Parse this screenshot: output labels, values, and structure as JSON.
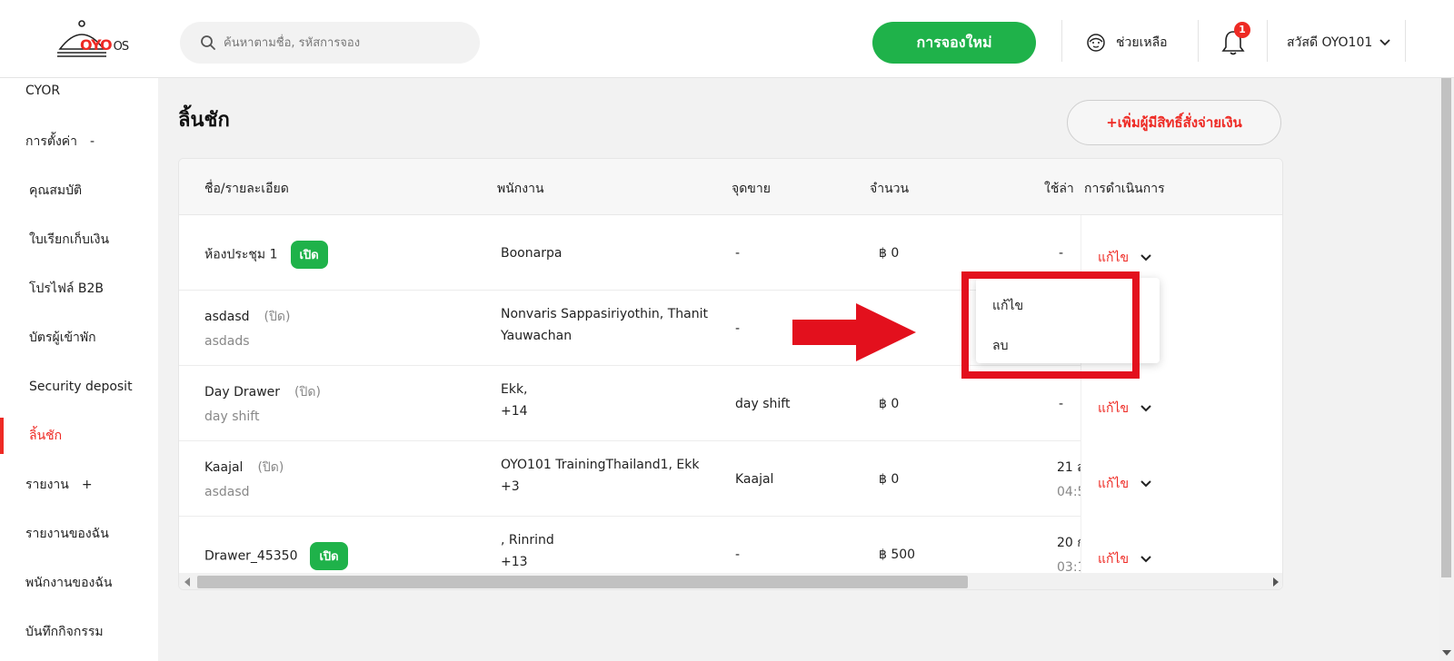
{
  "header": {
    "logo_brand": "OYO",
    "logo_suffix": "OS",
    "search_placeholder": "ค้นหาตามชื่อ, รหัสการจอง",
    "new_booking_label": "การจองใหม่",
    "help_label": "ช่วยเหลือ",
    "notification_count": "1",
    "user_greeting": "สวัสดี OYO101"
  },
  "sidebar": {
    "items": [
      {
        "label": "CYOR",
        "sign": ""
      },
      {
        "label": "การตั้งค่า",
        "sign": "-"
      },
      {
        "label": "คุณสมบัติ",
        "sign": ""
      },
      {
        "label": "ใบเรียกเก็บเงิน",
        "sign": ""
      },
      {
        "label": "โปรไฟล์ B2B",
        "sign": ""
      },
      {
        "label": "บัตรผู้เข้าพัก",
        "sign": ""
      },
      {
        "label": "Security deposit",
        "sign": ""
      },
      {
        "label": "ลิ้นชัก",
        "sign": ""
      },
      {
        "label": "รายงาน",
        "sign": "+"
      },
      {
        "label": "รายงานของฉัน",
        "sign": ""
      },
      {
        "label": "พนักงานของฉัน",
        "sign": ""
      },
      {
        "label": "บันทึกกิจกรรม",
        "sign": ""
      }
    ]
  },
  "page": {
    "title": "ลิ้นชัก",
    "add_button_label": "+เพิ่มผู้มีสิทธิ์สั่งจ่ายเงิน"
  },
  "table": {
    "headers": [
      "ชื่อ/รายละเอียด",
      "พนักงาน",
      "จุดขาย",
      "จำนวน",
      "ใช้ล่า",
      "การดำเนินการ"
    ],
    "rows": [
      {
        "name": "ห้องประชุม 1",
        "status": "เปิด",
        "status_type": "open",
        "detail": "",
        "staff_line1": "Boonarpa",
        "staff_line2": "",
        "pos": "-",
        "amount": "฿ 0",
        "last_used_1": "-",
        "last_used_2": "",
        "action": "แก้ไข"
      },
      {
        "name": "asdasd",
        "status": "(ปิด)",
        "status_type": "closed",
        "detail": "asdads",
        "staff_line1": "Nonvaris Sappasiriyothin, Thanit",
        "staff_line2": "Yauwachan",
        "pos": "-",
        "amount": "",
        "last_used_1": "",
        "last_used_2": "",
        "action": ""
      },
      {
        "name": "Day Drawer",
        "status": "(ปิด)",
        "status_type": "closed",
        "detail": "day shift",
        "staff_line1": "Ekk,",
        "staff_line2": "+14",
        "pos": "day shift",
        "amount": "฿ 0",
        "last_used_1": "-",
        "last_used_2": "",
        "action": "แก้ไข"
      },
      {
        "name": "Kaajal",
        "status": "(ปิด)",
        "status_type": "closed",
        "detail": "asdasd",
        "staff_line1": "OYO101 TrainingThailand1, Ekk",
        "staff_line2": "+3",
        "pos": "Kaajal",
        "amount": "฿ 0",
        "last_used_1": "21 ส",
        "last_used_2": "04:5",
        "action": "แก้ไข"
      },
      {
        "name": "Drawer_45350",
        "status": "เปิด",
        "status_type": "open",
        "detail": "",
        "staff_line1": ", Rinrind",
        "staff_line2": "+13",
        "pos": "-",
        "amount": "฿ 500",
        "last_used_1": "20 ก",
        "last_used_2": "03:1",
        "action": "แก้ไข"
      }
    ]
  },
  "dropdown": {
    "items": [
      "แก้ไข",
      "ลบ"
    ]
  },
  "colors": {
    "accent_red": "#ee2a24",
    "green": "#1fb24a",
    "annotation_red": "#e3101d"
  }
}
